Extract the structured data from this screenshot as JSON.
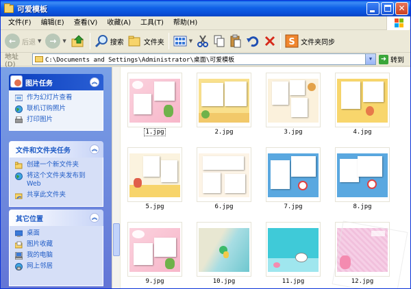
{
  "window": {
    "title": "可爱模板"
  },
  "menu": [
    "文件(F)",
    "编辑(E)",
    "查看(V)",
    "收藏(A)",
    "工具(T)",
    "帮助(H)"
  ],
  "toolbar": {
    "back": "后退",
    "search": "搜索",
    "folders": "文件夹",
    "sync": "文件夹同步"
  },
  "address": {
    "label": "地址(D)",
    "path": "C:\\Documents and Settings\\Administrator\\桌面\\可爱模板",
    "go": "转到"
  },
  "sidebar": {
    "picture_tasks": {
      "title": "图片任务",
      "items": [
        "作为幻灯片查看",
        "联机订购照片",
        "打印图片"
      ]
    },
    "file_tasks": {
      "title": "文件和文件夹任务",
      "items": [
        "创建一个新文件夹",
        "将这个文件夹发布到 Web",
        "共享此文件夹"
      ]
    },
    "other_places": {
      "title": "其它位置",
      "items": [
        "桌面",
        "图片收藏",
        "我的电脑",
        "网上邻居"
      ]
    }
  },
  "files": [
    {
      "name": "1.jpg",
      "selected": true,
      "theme": "pink"
    },
    {
      "name": "2.jpg",
      "selected": false,
      "theme": "yellow"
    },
    {
      "name": "3.jpg",
      "selected": false,
      "theme": "cream"
    },
    {
      "name": "4.jpg",
      "selected": false,
      "theme": "yellow"
    },
    {
      "name": "5.jpg",
      "selected": false,
      "theme": "cream"
    },
    {
      "name": "6.jpg",
      "selected": false,
      "theme": "cream"
    },
    {
      "name": "7.jpg",
      "selected": false,
      "theme": "blue"
    },
    {
      "name": "8.jpg",
      "selected": false,
      "theme": "blue"
    },
    {
      "name": "9.jpg",
      "selected": false,
      "theme": "pink"
    },
    {
      "name": "10.jpg",
      "selected": false,
      "theme": "sea"
    },
    {
      "name": "11.jpg",
      "selected": false,
      "theme": "cyan"
    },
    {
      "name": "12.jpg",
      "selected": false,
      "theme": "lilac"
    }
  ],
  "colors": {
    "titlebar": "#0a5fe6",
    "link": "#215dc6",
    "panel_bg": "#d6dff7"
  }
}
